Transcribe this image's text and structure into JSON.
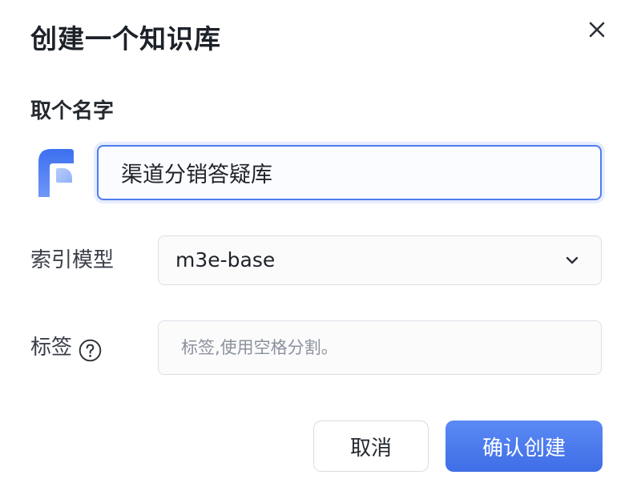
{
  "dialog": {
    "title": "创建一个知识库",
    "close_icon": "close-icon"
  },
  "name_section": {
    "label": "取个名字",
    "avatar_icon": "knowledge-base-logo-icon",
    "input_value": "渠道分销答疑库"
  },
  "index_model": {
    "label": "索引模型",
    "selected": "m3e-base",
    "chevron_icon": "chevron-down-icon"
  },
  "tags": {
    "label": "标签",
    "help_icon": "question-circle-icon",
    "placeholder": "标签,使用空格分割。",
    "value": ""
  },
  "actions": {
    "cancel_label": "取消",
    "confirm_label": "确认创建"
  },
  "colors": {
    "accent": "#4f7cf0",
    "confirm_gradient_top": "#5b8af5",
    "confirm_gradient_bottom": "#3f6de6"
  }
}
